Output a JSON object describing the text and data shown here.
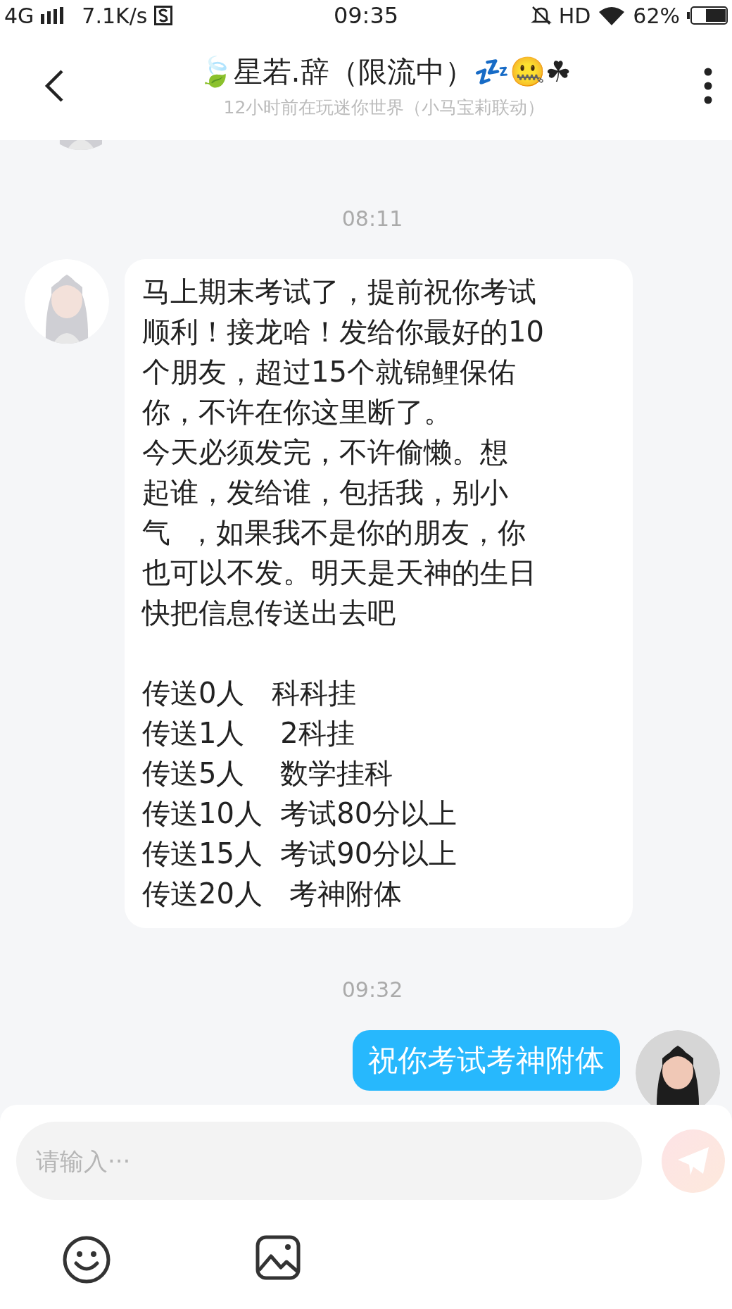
{
  "status_bar": {
    "network": "4G",
    "speed": "7.1K/s",
    "time": "09:35",
    "hd": "HD",
    "battery": "62%"
  },
  "header": {
    "title": "🍃星若.辞（限流中）💤🤐☘",
    "subtitle": "12小时前在玩迷你世界（小马宝莉联动）"
  },
  "messages": [
    {
      "kind": "time",
      "text": "08:11"
    },
    {
      "kind": "received",
      "paragraphs": [
        {
          "lines": [
            "马上期末考试了，提前祝你考试",
            "顺利！接龙哈！发给你最好的10",
            "个朋友，超过15个就锦鲤保佑",
            "你，不许在你这里断了。",
            "今天必须发完，不许偷懒。想",
            "起谁，发给谁，包括我，别小",
            "气  ，如果我不是你的朋友，你",
            "也可以不发。明天是天神的生日",
            "快把信息传送出去吧"
          ]
        },
        {
          "lines": [
            "传送0人   科科挂",
            "传送1人    2科挂",
            "传送5人    数学挂科",
            "传送10人  考试80分以上",
            "传送15人  考试90分以上",
            "传送20人   考神附体"
          ]
        }
      ]
    },
    {
      "kind": "time",
      "text": "09:32"
    },
    {
      "kind": "sent",
      "paragraphs": [
        {
          "lines": [
            "祝你考试考神附体"
          ]
        }
      ]
    }
  ],
  "input": {
    "placeholder": "请输入···"
  }
}
